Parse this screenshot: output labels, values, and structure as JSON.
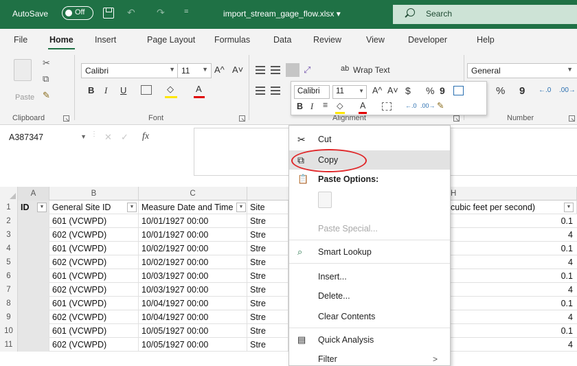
{
  "titlebar": {
    "autosave_label": "AutoSave",
    "autosave_state": "Off",
    "qat_more": "=",
    "filename": "import_stream_gage_flow.xlsx  ▾",
    "search_placeholder": "Search"
  },
  "ribbon_tabs": [
    "File",
    "Home",
    "Insert",
    "Page Layout",
    "Formulas",
    "Data",
    "Review",
    "View",
    "Developer",
    "Help"
  ],
  "active_tab": "Home",
  "ribbon": {
    "paste_label": "Paste",
    "font_name": "Calibri",
    "font_size": "11",
    "grow_font": "A^",
    "shrink_font": "A˅",
    "bold": "B",
    "italic": "I",
    "underline": "U",
    "wrap_text": "Wrap Text",
    "number_format": "General",
    "percent": "%",
    "comma": "9",
    "groups": {
      "clipboard": "Clipboard",
      "font": "Font",
      "alignment": "Alignment",
      "number": "Number"
    }
  },
  "minibar": {
    "font_name": "Calibri",
    "font_size": "11",
    "grow_font": "A^",
    "shrink_font": "A˅",
    "currency": "$",
    "percent": "%",
    "comma": "9",
    "bold": "B",
    "italic": "I"
  },
  "formula_bar": {
    "name_box": "A387347",
    "fx": "fx",
    "content": ""
  },
  "columns": [
    "A",
    "B",
    "C",
    "",
    "",
    "",
    "",
    "H"
  ],
  "headers": {
    "a": "ID",
    "b": "General Site ID",
    "c": "Measure Date and Time",
    "d": "Site",
    "h": "cubic feet per second)"
  },
  "rows": [
    {
      "num": "2",
      "b": "601 (VCWPD)",
      "c": "10/01/1927 00:00",
      "d": "Stre",
      "h": "0.1"
    },
    {
      "num": "3",
      "b": "602 (VCWPD)",
      "c": "10/01/1927 00:00",
      "d": "Stre",
      "h": "4"
    },
    {
      "num": "4",
      "b": "601 (VCWPD)",
      "c": "10/02/1927 00:00",
      "d": "Stre",
      "h": "0.1"
    },
    {
      "num": "5",
      "b": "602 (VCWPD)",
      "c": "10/02/1927 00:00",
      "d": "Stre",
      "h": "4"
    },
    {
      "num": "6",
      "b": "601 (VCWPD)",
      "c": "10/03/1927 00:00",
      "d": "Stre",
      "h": "0.1"
    },
    {
      "num": "7",
      "b": "602 (VCWPD)",
      "c": "10/03/1927 00:00",
      "d": "Stre",
      "h": "4"
    },
    {
      "num": "8",
      "b": "601 (VCWPD)",
      "c": "10/04/1927 00:00",
      "d": "Stre",
      "h": "0.1"
    },
    {
      "num": "9",
      "b": "602 (VCWPD)",
      "c": "10/04/1927 00:00",
      "d": "Stre",
      "h": "4"
    },
    {
      "num": "10",
      "b": "601 (VCWPD)",
      "c": "10/05/1927 00:00",
      "d": "Stre",
      "h": "0.1"
    },
    {
      "num": "11",
      "b": "602 (VCWPD)",
      "c": "10/05/1927 00:00",
      "d": "Stre",
      "h": "4"
    }
  ],
  "header_row_num": "1",
  "context_menu": {
    "cut": "Cut",
    "copy": "Copy",
    "paste_options": "Paste Options:",
    "paste_special": "Paste Special...",
    "smart_lookup": "Smart Lookup",
    "insert": "Insert...",
    "delete": "Delete...",
    "clear_contents": "Clear Contents",
    "quick_analysis": "Quick Analysis",
    "filter": "Filter",
    "filter_arrow": ">"
  },
  "colors": {
    "excel_green": "#1f7145",
    "highlight_ring": "#e0282a",
    "menu_hover": "#e2e2e2"
  }
}
